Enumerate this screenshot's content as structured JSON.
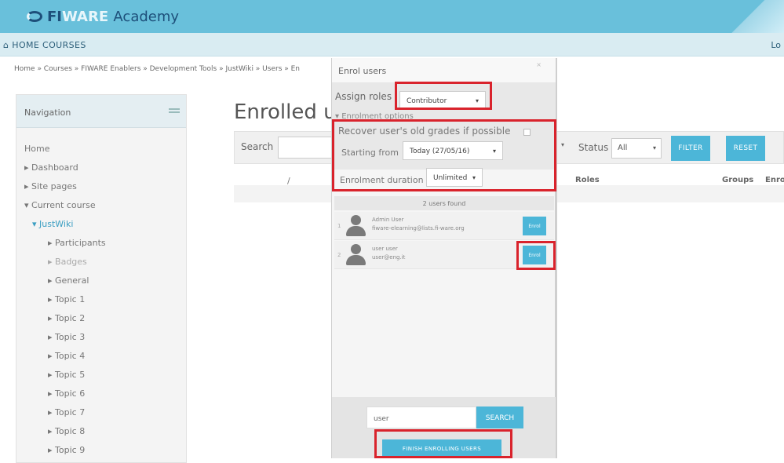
{
  "header": {
    "logo_text_1": "FI",
    "logo_text_2": "WARE",
    "logo_text_3": "Academy"
  },
  "navbar": {
    "home": "HOME",
    "courses": "COURSES",
    "right_text": "Lo"
  },
  "breadcrumb": "Home » Courses » FIWARE Enablers » Development Tools » JustWiki » Users » En",
  "sidebar": {
    "title": "Navigation",
    "items": [
      {
        "label": "Home"
      },
      {
        "label": "Dashboard"
      },
      {
        "label": "Site pages"
      },
      {
        "label": "Current course"
      },
      {
        "label": "JustWiki"
      },
      {
        "label": "Participants"
      },
      {
        "label": "Badges"
      },
      {
        "label": "General"
      },
      {
        "label": "Topic 1"
      },
      {
        "label": "Topic 2"
      },
      {
        "label": "Topic 3"
      },
      {
        "label": "Topic 4"
      },
      {
        "label": "Topic 5"
      },
      {
        "label": "Topic 6"
      },
      {
        "label": "Topic 7"
      },
      {
        "label": "Topic 8"
      },
      {
        "label": "Topic 9"
      }
    ]
  },
  "main": {
    "heading": "Enrolled u",
    "search_label": "Search",
    "status_label": "Status",
    "status_value": "All",
    "filter_button": "FILTER",
    "reset_button": "RESET",
    "columns": {
      "sort_mark": "/",
      "roles": "Roles",
      "groups": "Groups",
      "enrol": "Enro"
    }
  },
  "dialog": {
    "title": "Enrol users",
    "assign_roles_label": "Assign roles",
    "assign_roles_value": "Contributor",
    "enrolment_options": "Enrolment options",
    "recover_grades_label": "Recover user's old grades if possible",
    "starting_from_label": "Starting from",
    "starting_from_value": "Today (27/05/16)",
    "duration_label": "Enrolment duration",
    "duration_value": "Unlimited",
    "users_found": "2 users found",
    "users": [
      {
        "num": "1",
        "name": "Admin User",
        "email": "fiware-elearning@lists.fi-ware.org",
        "enrol_label": "Enrol"
      },
      {
        "num": "2",
        "name": "user user",
        "email": "user@eng.it",
        "enrol_label": "Enrol"
      }
    ],
    "search_value": "user",
    "search_button": "SEARCH",
    "finish_button": "FINISH ENROLLING USERS"
  },
  "colors": {
    "topbar": "#69c0db",
    "accent_button": "#4cb6d8",
    "highlight": "#d9232c"
  }
}
